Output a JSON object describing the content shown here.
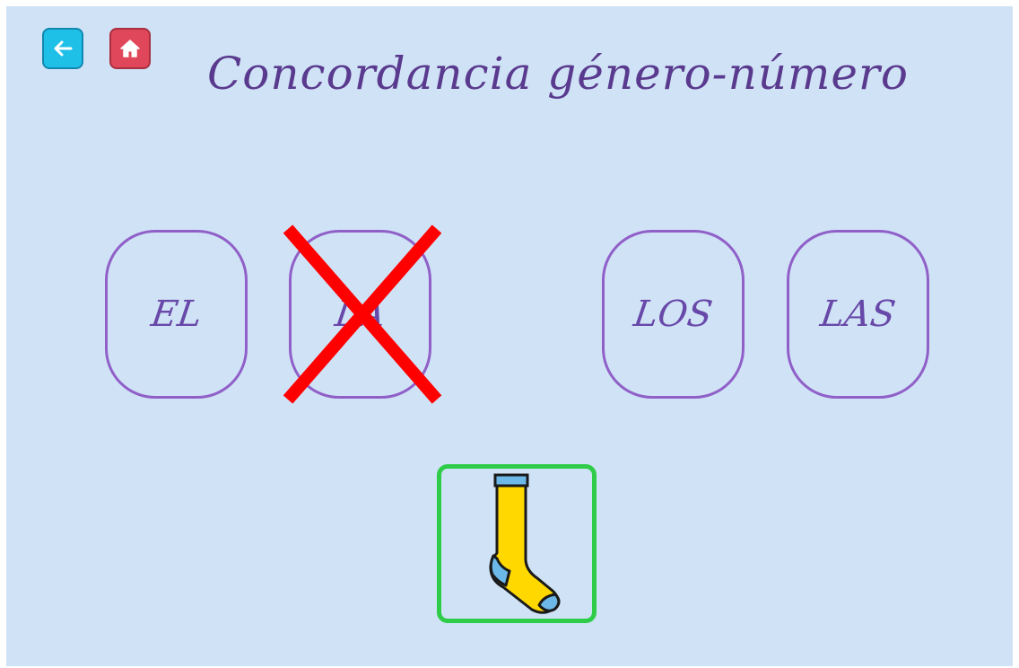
{
  "title": "Concordancia género-número",
  "nav": {
    "back_icon": "arrow-left-icon",
    "home_icon": "home-icon",
    "back_color": "#1ec0e8",
    "home_color": "#e0475a"
  },
  "articles": [
    {
      "label": "EL",
      "state": "default"
    },
    {
      "label": "LA",
      "state": "crossed-out"
    },
    {
      "label": "LOS",
      "state": "default"
    },
    {
      "label": "LAS",
      "state": "default"
    }
  ],
  "picture": {
    "icon": "sock-icon",
    "border_color": "#2ecc48"
  },
  "colors": {
    "background": "#d0e3f6",
    "title": "#5a3a8e",
    "article_border": "#9060c8",
    "cross": "#ff0000"
  }
}
